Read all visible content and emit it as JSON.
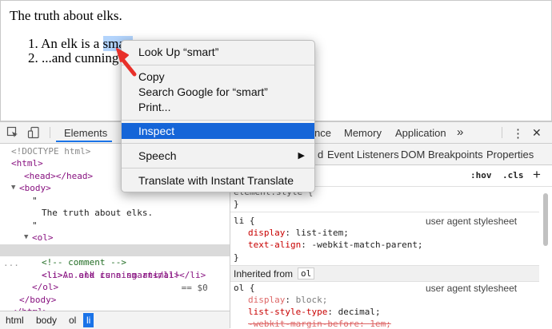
{
  "page": {
    "heading": "The truth about elks.",
    "list": [
      {
        "num": "1.",
        "before": "An elk is a ",
        "selected": "smart"
      },
      {
        "num": "2.",
        "text": "...and cunning a"
      }
    ]
  },
  "devtools": {
    "tabs": {
      "elements": "Elements",
      "performance_partial": "nce",
      "memory": "Memory",
      "application": "Application",
      "more": "»"
    },
    "toolbar_menu": "⋮",
    "toolbar_close": "✕",
    "dom": {
      "doctype": "<!DOCTYPE html>",
      "html_open": "<html>",
      "head": "<head></head>",
      "body_open": "<body>",
      "quote1": "\"",
      "text": "The truth about elks.",
      "quote2": "\"",
      "ol_open": "<ol>",
      "li1": "<li>An elk is a smart</li>",
      "eq": " == $0",
      "comment": "<!-- comment -->",
      "li2": "<li>...and cunning animal!</li>",
      "ol_close": "</ol>",
      "body_close": "</body>",
      "html_close": "</html>",
      "ellipsis": "..."
    },
    "breadcrumbs": [
      "html",
      "body",
      "ol",
      "li"
    ],
    "subtabs": {
      "partial": "d",
      "event_listeners": "Event Listeners",
      "dom_breakpoints": "DOM Breakpoints",
      "properties": "Properties"
    },
    "filter": {
      "hov": ":hov",
      "cls": ".cls",
      "plus": "+"
    },
    "styles": {
      "element_style_partial": "element.style {",
      "close1": "}",
      "li_selector": "li {",
      "ua1": "user agent stylesheet",
      "display_prop": "display",
      "display_val": "list-item;",
      "text_align_prop": "text-align",
      "text_align_val": "-webkit-match-parent;",
      "close2": "}",
      "inherited_label": "Inherited from",
      "inherited_tag": "ol",
      "ol_selector": "ol {",
      "ua2": "user agent stylesheet",
      "ol_display_prop": "display",
      "ol_display_val": "block;",
      "lst_prop": "list-style-type",
      "lst_val": "decimal;",
      "margin_prop": "-webkit-margin-before",
      "margin_val": "1em;"
    }
  },
  "context_menu": {
    "look_up": "Look Up “smart”",
    "copy": "Copy",
    "search_google": "Search Google for “smart”",
    "print": "Print...",
    "inspect": "Inspect",
    "speech": "Speech",
    "speech_arrow": "▶",
    "translate": "Translate with Instant Translate"
  },
  "colors": {
    "accent": "#1a73e8",
    "menu_highlight": "#1565d8",
    "pointer": "#e8302a"
  }
}
